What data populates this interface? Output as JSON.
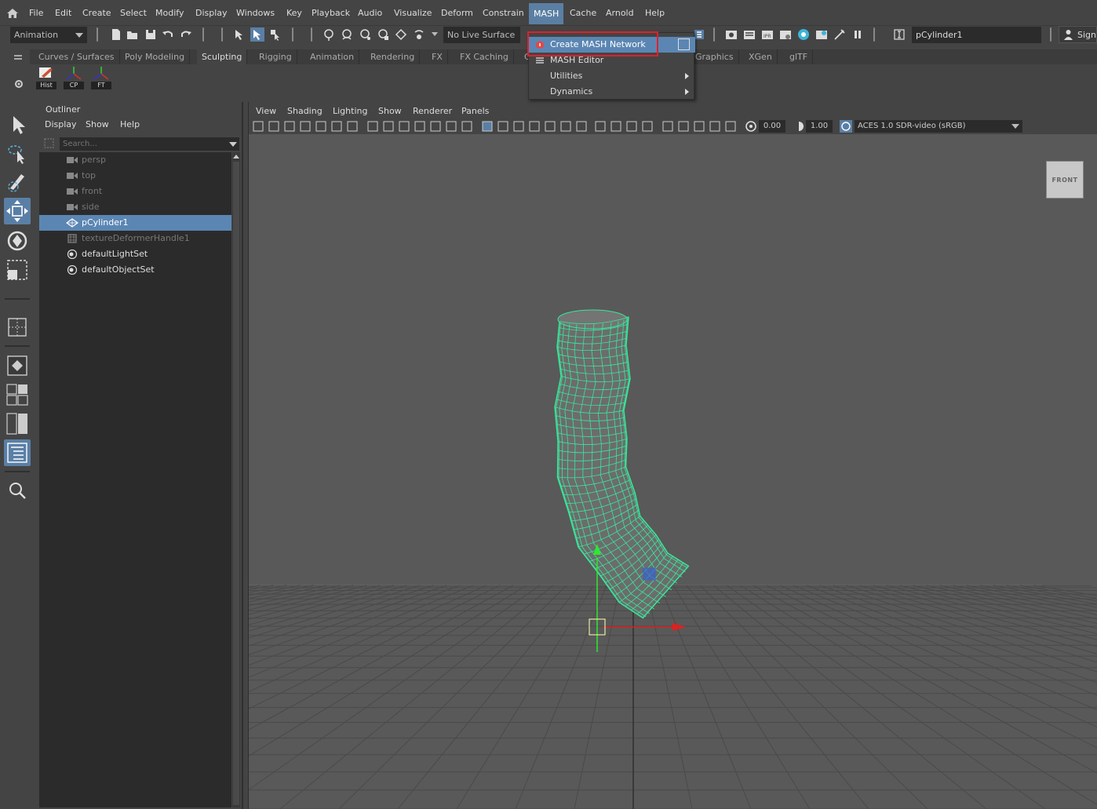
{
  "menubar": {
    "items": [
      "File",
      "Edit",
      "Create",
      "Select",
      "Modify",
      "Display",
      "Windows",
      "Key",
      "Playback",
      "Audio",
      "Visualize",
      "Deform",
      "Constrain",
      "MASH",
      "Cache",
      "Arnold",
      "Help"
    ],
    "active": "MASH"
  },
  "statusline": {
    "menuset": "Animation",
    "live_surface": "No Live Surface",
    "object_field": "pCylinder1",
    "sign_in": "Sign"
  },
  "shelf": {
    "tabs": [
      "Curves / Surfaces",
      "Poly Modeling",
      "Sculpting",
      "Rigging",
      "Animation",
      "Rendering",
      "FX",
      "FX Caching",
      "C",
      "Graphics",
      "XGen",
      "glTF"
    ],
    "buttons": [
      "Hist",
      "CP",
      "FT"
    ]
  },
  "outliner": {
    "title": "Outliner",
    "menu": [
      "Display",
      "Show",
      "Help"
    ],
    "search_placeholder": "Search...",
    "items": [
      {
        "label": "persp",
        "icon": "camera-icon",
        "state": "dim"
      },
      {
        "label": "top",
        "icon": "camera-icon",
        "state": "dim"
      },
      {
        "label": "front",
        "icon": "camera-icon",
        "state": "dim"
      },
      {
        "label": "side",
        "icon": "camera-icon",
        "state": "dim"
      },
      {
        "label": "pCylinder1",
        "icon": "mesh-icon",
        "state": "selected"
      },
      {
        "label": "textureDeformerHandle1",
        "icon": "deformer-icon",
        "state": "dim"
      },
      {
        "label": "defaultLightSet",
        "icon": "set-icon",
        "state": "normal"
      },
      {
        "label": "defaultObjectSet",
        "icon": "set-icon",
        "state": "normal"
      }
    ]
  },
  "viewport": {
    "menu": [
      "View",
      "Shading",
      "Lighting",
      "Show",
      "Renderer",
      "Panels"
    ],
    "exposure": "0.00",
    "gamma": "1.00",
    "color_space": "ACES 1.0 SDR-video (sRGB)",
    "viewcube_label": "FRONT"
  },
  "mash_menu": {
    "items": [
      {
        "label": "Create MASH Network",
        "highlighted": true,
        "submenu": false
      },
      {
        "label": "MASH Editor",
        "highlighted": false,
        "submenu": false
      },
      {
        "label": "Utilities",
        "highlighted": false,
        "submenu": true
      },
      {
        "label": "Dynamics",
        "highlighted": false,
        "submenu": true
      }
    ]
  },
  "colors": {
    "highlight": "#5b86b3",
    "wireframe": "#36e89a",
    "annotation": "#e0202a"
  }
}
